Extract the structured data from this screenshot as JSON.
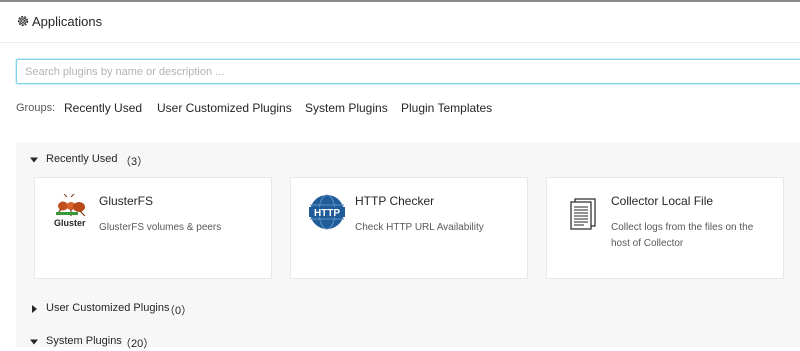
{
  "header": {
    "title": "Applications",
    "icon": "gear-icon"
  },
  "search": {
    "placeholder": "Search plugins by name or description ...",
    "value": ""
  },
  "groups": {
    "label": "Groups:",
    "items": [
      "Recently Used",
      "User Customized Plugins",
      "System Plugins",
      "Plugin Templates"
    ]
  },
  "sections": [
    {
      "name": "Recently Used",
      "count": "（3）",
      "expanded": true
    },
    {
      "name": "User Customized Plugins",
      "count": "（0）",
      "expanded": false
    },
    {
      "name": "System Plugins",
      "count": "（20）",
      "expanded": true
    }
  ],
  "cards": [
    {
      "title": "GlusterFS",
      "description": "GlusterFS volumes & peers",
      "icon": "glusterfs-ant-logo",
      "icon_text": "Gluster"
    },
    {
      "title": "HTTP Checker",
      "description": "Check HTTP URL Availability",
      "icon": "http-globe-icon",
      "icon_text": "HTTP"
    },
    {
      "title": "Collector Local File",
      "description": "Collect logs from the files on the host of Collector",
      "icon": "document-stack-icon"
    }
  ],
  "colors": {
    "accent": "#7fd4ea",
    "http_blue": "#1f5c99",
    "panel": "#f7f7f7"
  }
}
